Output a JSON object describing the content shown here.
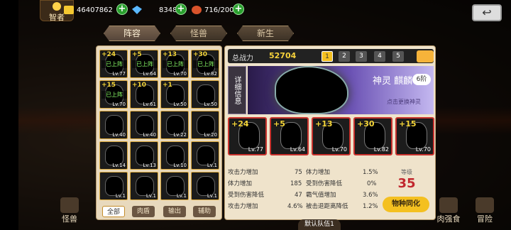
{
  "topbar": {
    "role_label": "智者",
    "gold": "46407862",
    "gems": "8348",
    "stamina": "716/200"
  },
  "tabs": [
    "阵容",
    "怪兽",
    "新生"
  ],
  "roster": [
    {
      "star": "+24",
      "status": "已上阵",
      "level": "Lv.77"
    },
    {
      "star": "+5",
      "status": "已上阵",
      "level": "Lv.64"
    },
    {
      "star": "+13",
      "status": "已上阵",
      "level": "Lv.70"
    },
    {
      "star": "+30",
      "status": "已上阵",
      "level": "Lv.82"
    },
    {
      "star": "+15",
      "status": "已上阵",
      "level": "Lv.70"
    },
    {
      "star": "+10",
      "status": "",
      "level": "Lv.61"
    },
    {
      "star": "+1",
      "status": "",
      "level": "Lv.50"
    },
    {
      "star": "",
      "status": "",
      "level": "Lv.50"
    },
    {
      "star": "",
      "status": "",
      "level": "Lv.40"
    },
    {
      "star": "",
      "status": "",
      "level": "Lv.40"
    },
    {
      "star": "",
      "status": "",
      "level": "Lv.22"
    },
    {
      "star": "",
      "status": "",
      "level": "Lv.20"
    },
    {
      "star": "",
      "status": "",
      "level": "Lv.14"
    },
    {
      "star": "",
      "status": "",
      "level": "Lv.13"
    },
    {
      "star": "",
      "status": "",
      "level": "Lv.10"
    },
    {
      "star": "",
      "status": "",
      "level": "Lv.1"
    },
    {
      "star": "",
      "status": "",
      "level": "Lv.1"
    },
    {
      "star": "",
      "status": "",
      "level": "Lv.1"
    },
    {
      "star": "",
      "status": "",
      "level": "Lv.1"
    },
    {
      "star": "",
      "status": "",
      "level": "Lv.1"
    }
  ],
  "filters": [
    "全部",
    "肉盾",
    "输出",
    "辅助"
  ],
  "right": {
    "power_label": "总战力",
    "power_value": "52704",
    "pages": [
      "1",
      "2",
      "3",
      "4",
      "5"
    ],
    "detail_label": "详细信息",
    "god_name": "神灵 麒麟",
    "tier": "6阶",
    "change_hint": "点击更换神灵",
    "team": [
      {
        "star": "+24",
        "level": "Lv.77"
      },
      {
        "star": "+5",
        "level": "Lv.64"
      },
      {
        "star": "+13",
        "level": "Lv.70"
      },
      {
        "star": "+30",
        "level": "Lv.82"
      },
      {
        "star": "+15",
        "level": "Lv.70"
      }
    ],
    "stats": [
      {
        "l1": "攻击力增加",
        "v1": "75",
        "l2": "体力增加",
        "v2": "1.5%"
      },
      {
        "l1": "体力增加",
        "v1": "185",
        "l2": "受到伤害降低",
        "v2": "0%"
      },
      {
        "l1": "受到伤害降低",
        "v1": "47",
        "l2": "霸气值增加",
        "v2": "3.6%"
      },
      {
        "l1": "攻击力增加",
        "v1": "4.6%",
        "l2": "被击退距离降低",
        "v2": "1.2%"
      }
    ],
    "level_label": "等级",
    "level_value": "35",
    "evolve_label": "物种同化",
    "team_label": "默认队伍1"
  },
  "bottom": [
    "怪兽",
    "肉强食",
    "冒险"
  ]
}
